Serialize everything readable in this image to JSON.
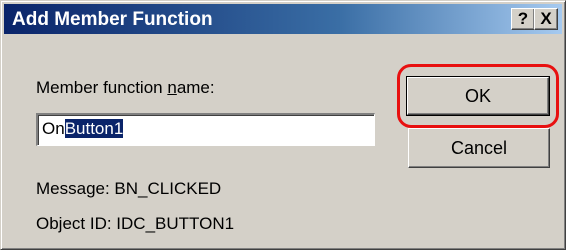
{
  "dialog": {
    "title": "Add Member Function",
    "help_button": "?",
    "close_button": "X"
  },
  "form": {
    "name_label_prefix": "Member function ",
    "name_label_accel": "n",
    "name_label_suffix": "ame:",
    "name_value_unselected": "On",
    "name_value_selected": "Button1"
  },
  "buttons": {
    "ok_label": "OK",
    "cancel_label": "Cancel"
  },
  "info": {
    "message": "Message: BN_CLICKED",
    "object_id": "Object ID: IDC_BUTTON1"
  },
  "colors": {
    "title_bar": "#0a246a",
    "dialog_face": "#d4d0c8",
    "selection": "#0a246a",
    "annotation": "#e81010"
  },
  "icons": {
    "help": "question-mark-icon",
    "close": "close-icon"
  }
}
